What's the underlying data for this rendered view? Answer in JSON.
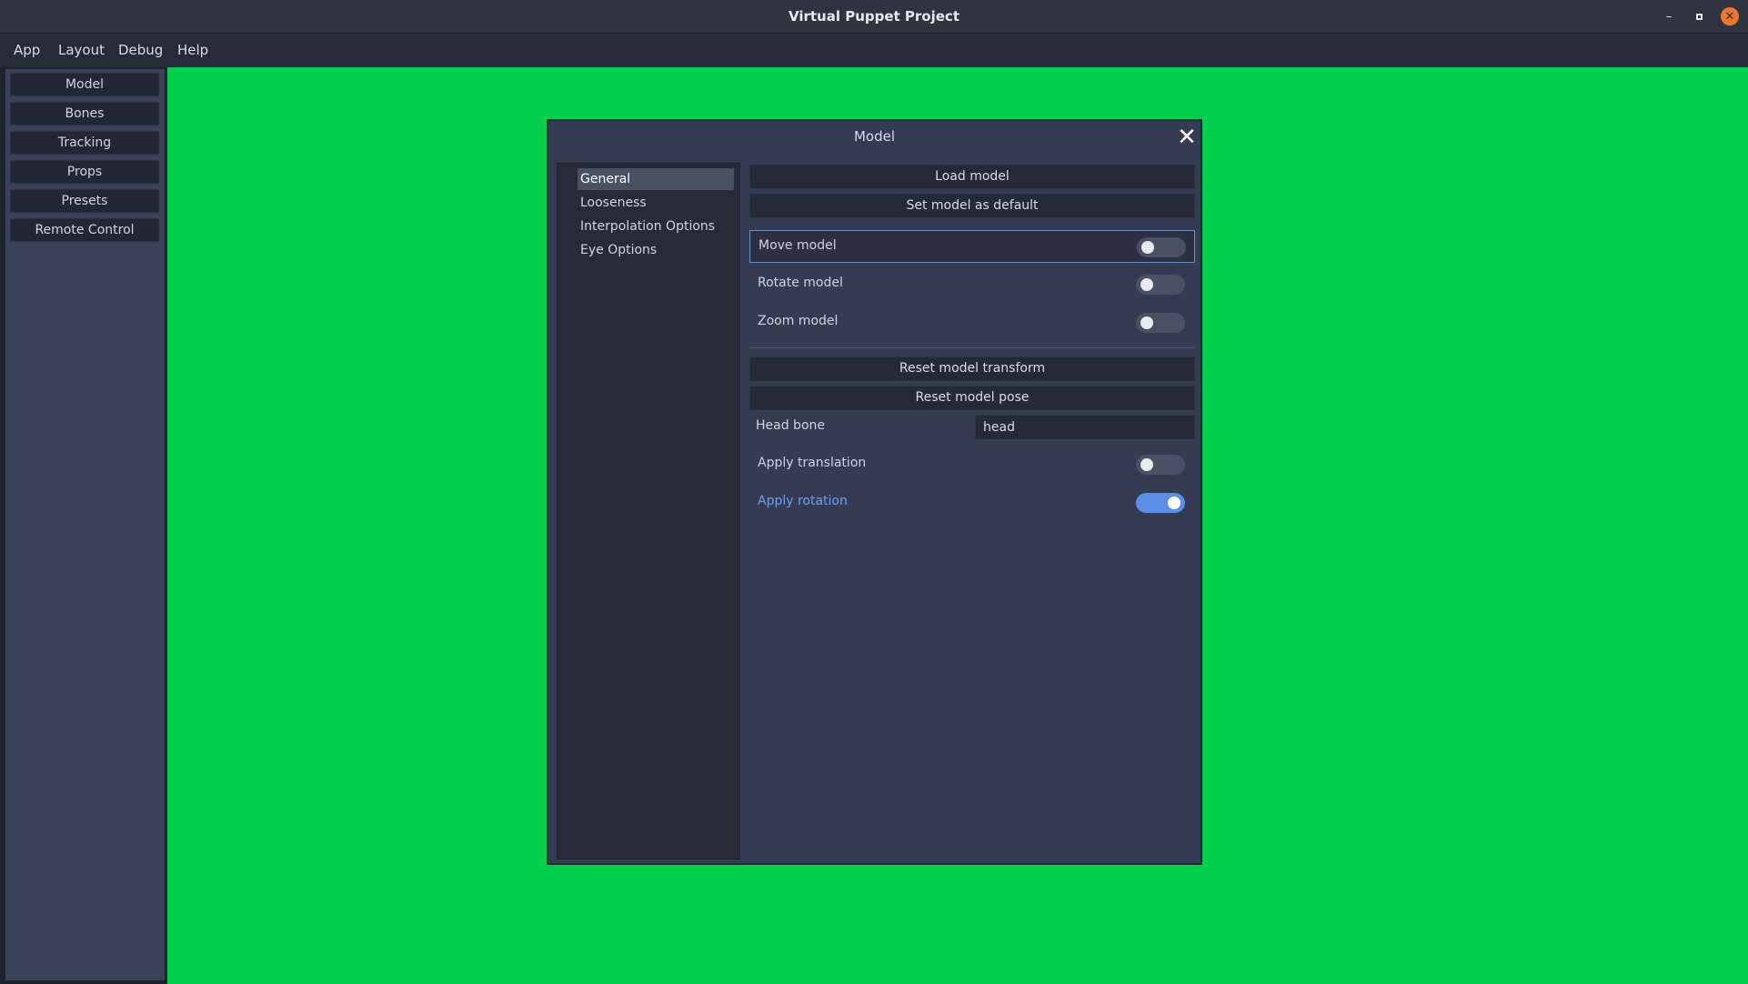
{
  "window": {
    "title": "Virtual Puppet Project",
    "min_icon": "minimize-icon",
    "max_icon": "maximize-icon",
    "close_icon": "close-icon",
    "close_color": "#f0752f"
  },
  "menu": [
    "App",
    "Layout",
    "Debug",
    "Help"
  ],
  "sidebar": {
    "buttons": [
      "Model",
      "Bones",
      "Tracking",
      "Props",
      "Presets",
      "Remote Control"
    ]
  },
  "viewport": {
    "background": "#00d04c"
  },
  "dialog": {
    "title": "Model",
    "tabs": [
      "General",
      "Looseness",
      "Interpolation Options",
      "Eye Options"
    ],
    "active_tab": "General",
    "load_model": "Load model",
    "set_default": "Set model as default",
    "move_model": {
      "label": "Move model",
      "on": false
    },
    "rotate_model": {
      "label": "Rotate model",
      "on": false
    },
    "zoom_model": {
      "label": "Zoom model",
      "on": false
    },
    "reset_transform": "Reset model transform",
    "reset_pose": "Reset model pose",
    "head_bone": {
      "label": "Head bone",
      "value": "head"
    },
    "apply_translation": {
      "label": "Apply translation",
      "on": false
    },
    "apply_rotation": {
      "label": "Apply rotation",
      "on": true
    },
    "accent": "#5b8ee6"
  }
}
